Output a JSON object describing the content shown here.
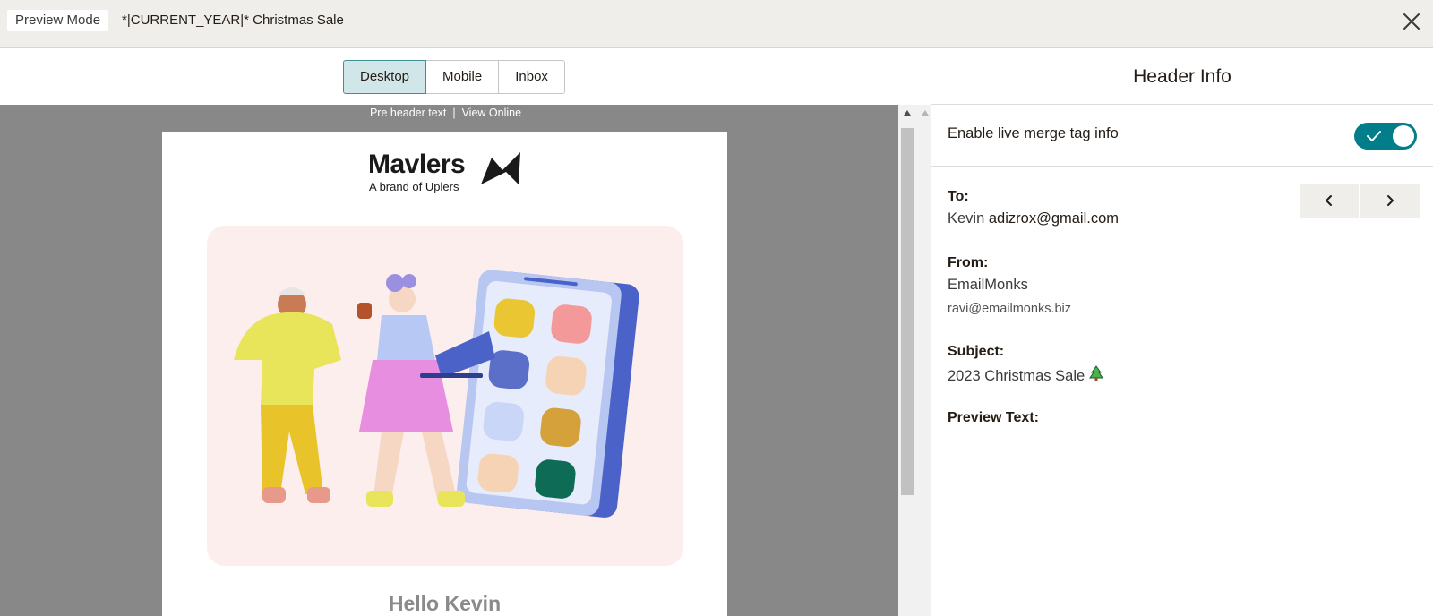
{
  "topbar": {
    "mode_label": "Preview Mode",
    "campaign_title": "*|CURRENT_YEAR|* Christmas Sale",
    "close_icon": "close-icon"
  },
  "view_tabs": [
    {
      "label": "Desktop",
      "active": true
    },
    {
      "label": "Mobile",
      "active": false
    },
    {
      "label": "Inbox",
      "active": false
    }
  ],
  "preview": {
    "preheader_text": "Pre header text",
    "separator": "|",
    "view_online": "View Online",
    "email": {
      "logo_word": "Mavlers",
      "logo_tagline": "A brand of Uplers",
      "greeting": "Hello Kevin"
    }
  },
  "panel": {
    "title": "Header Info",
    "merge_toggle_label": "Enable live merge tag info",
    "merge_toggle_on": true,
    "accent_color": "#017e89",
    "to": {
      "label": "To:",
      "name": "Kevin",
      "email": "adizrox@gmail.com"
    },
    "from": {
      "label": "From:",
      "name": "EmailMonks",
      "email": "ravi@emailmonks.biz"
    },
    "subject": {
      "label": "Subject:",
      "value": "2023 Christmas Sale",
      "emoji_icon": "christmas-tree-icon"
    },
    "preview_text": {
      "label": "Preview Text:",
      "value": ""
    },
    "nav": {
      "prev_icon": "chevron-left-icon",
      "next_icon": "chevron-right-icon"
    }
  }
}
